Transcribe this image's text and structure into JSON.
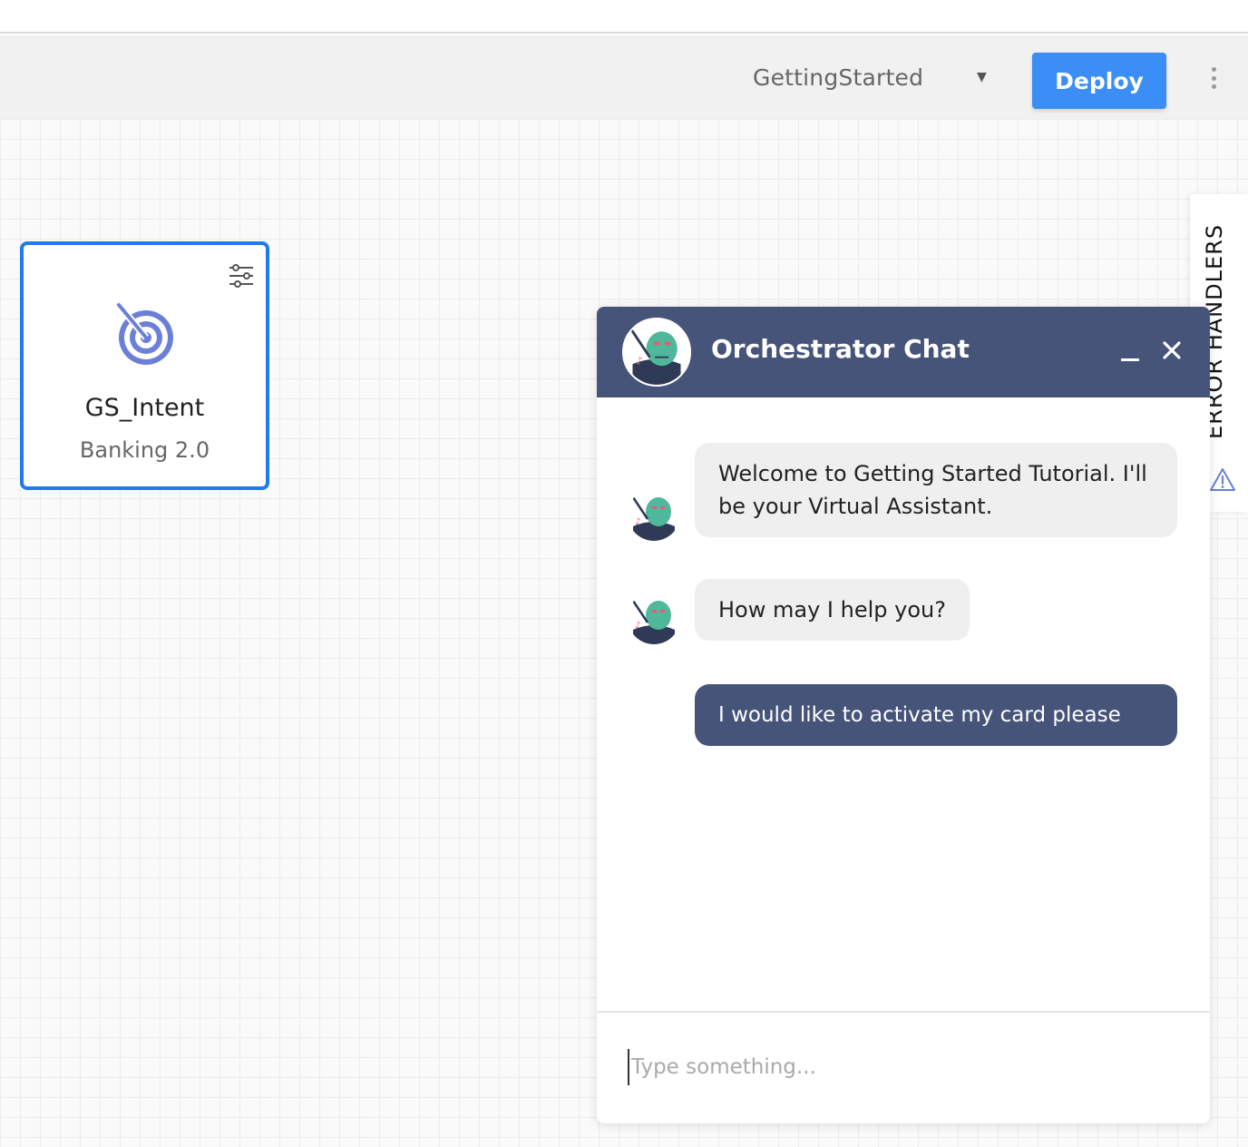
{
  "toolbar": {
    "flow_name": "GettingStarted",
    "deploy_label": "Deploy"
  },
  "node": {
    "title": "GS_Intent",
    "subtitle": "Banking 2.0",
    "icon": "target-icon",
    "settings_icon": "sliders-icon"
  },
  "error_tab": {
    "label": "ERROR HANDLERS",
    "icon": "warning-icon"
  },
  "chat": {
    "title": "Orchestrator Chat",
    "messages": [
      {
        "sender": "bot",
        "text": "Welcome to Getting Started Tutorial. I'll be your Virtual Assistant."
      },
      {
        "sender": "bot",
        "text": "How may I help you?"
      },
      {
        "sender": "user",
        "text": "I would like to activate my card please"
      }
    ],
    "input_placeholder": "Type something..."
  },
  "colors": {
    "accent_blue": "#3a8ef5",
    "node_border": "#1e7bf0",
    "chat_header": "#47547a",
    "bot_bubble": "#efefef",
    "user_bubble": "#47547a",
    "icon_purple": "#6b7fd7"
  }
}
